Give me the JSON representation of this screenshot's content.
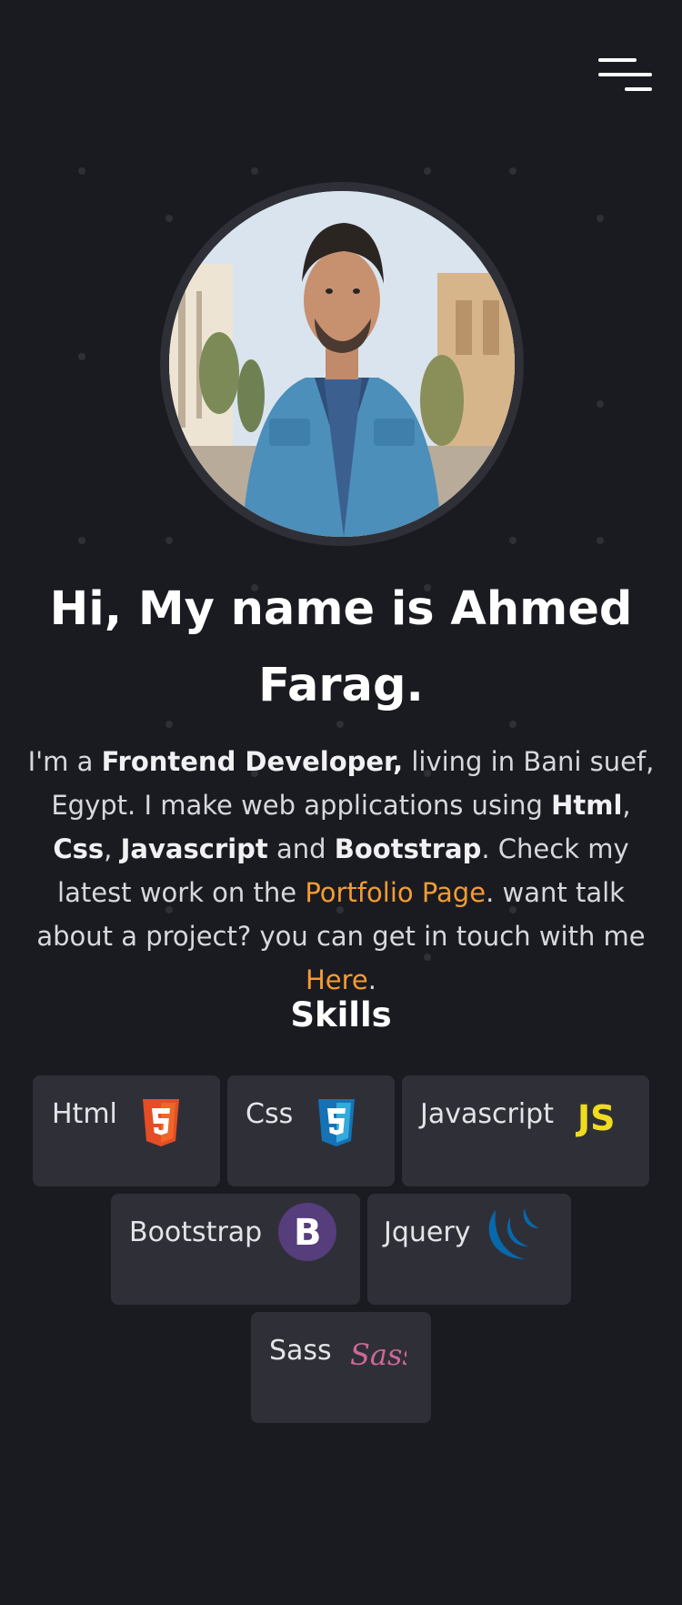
{
  "hero": {
    "greeting": "Hi, My name is Ahmed Farag.",
    "intro_im_a": "I'm a ",
    "intro_role": "Frontend Developer,",
    "intro_location": " living in Bani suef, Egypt. I make web applications using ",
    "skill_html": "Html",
    "comma1": ", ",
    "skill_css": "Css",
    "comma2": ", ",
    "skill_js": "Javascript",
    "and": " and ",
    "skill_bootstrap": "Bootstrap",
    "check_work": ". Check my latest work on the ",
    "portfolio_link": "Portfolio Page",
    "want_talk": ". want talk about a project? you can get in touch with me ",
    "here_link": "Here",
    "period": "."
  },
  "skills": {
    "title": "Skills",
    "items": [
      {
        "label": "Html",
        "icon": "html5-icon",
        "color": "#e44d26"
      },
      {
        "label": "Css",
        "icon": "css3-icon",
        "color": "#1572b6"
      },
      {
        "label": "Javascript",
        "icon": "javascript-icon",
        "color": "#f0db4f"
      },
      {
        "label": "Bootstrap",
        "icon": "bootstrap-icon",
        "color": "#563d7c"
      },
      {
        "label": "Jquery",
        "icon": "jquery-icon",
        "color": "#0769ad"
      },
      {
        "label": "Sass",
        "icon": "sass-icon",
        "color": "#cd6799"
      }
    ]
  },
  "colors": {
    "background": "#1a1b20",
    "card": "#2f3037",
    "accent": "#f39b34"
  }
}
